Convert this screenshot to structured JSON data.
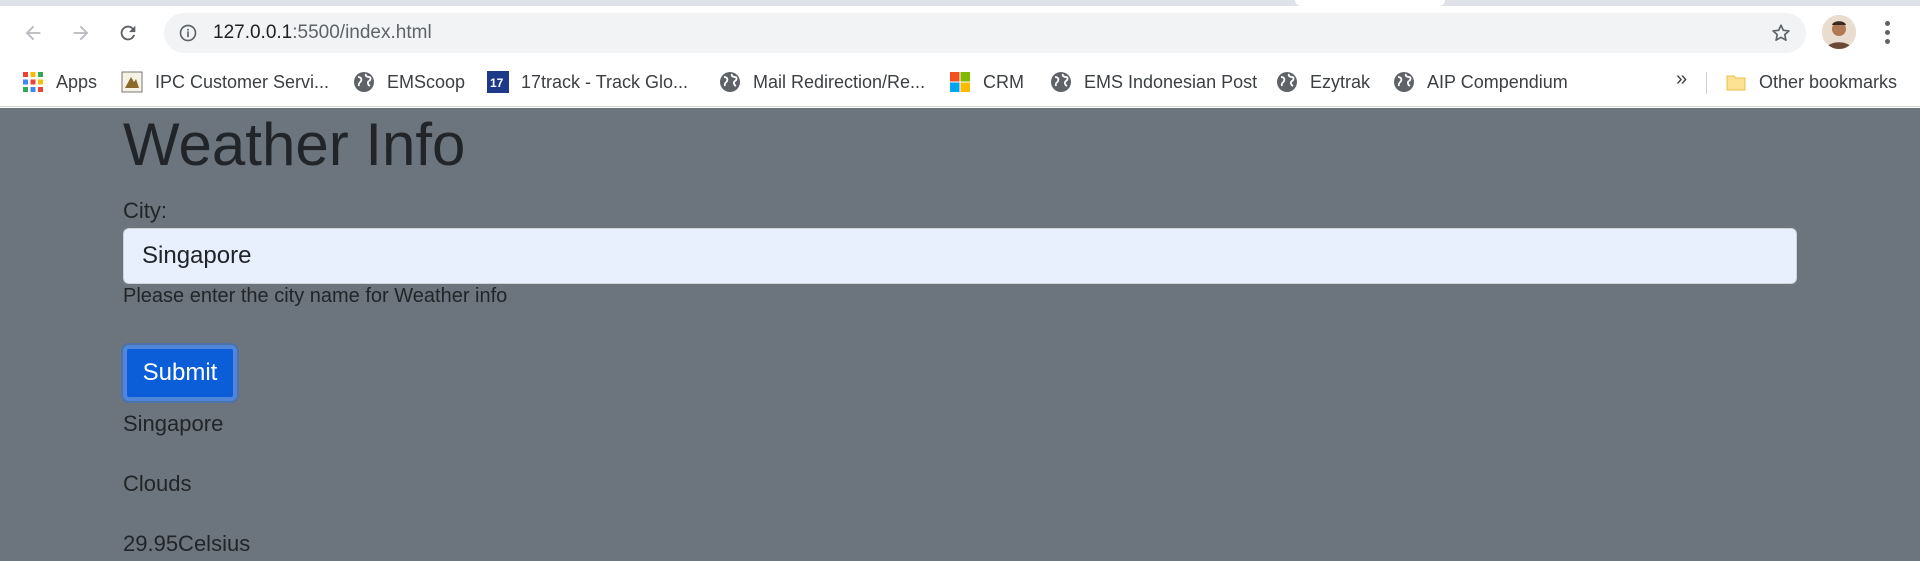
{
  "browser": {
    "url_host": "127.0.0.1",
    "url_path": ":5500/index.html",
    "bookmarks_more": "»",
    "bookmarks": [
      {
        "label": "Apps",
        "icon": "apps-grid-icon"
      },
      {
        "label": "IPC Customer Servi...",
        "icon": "ipc-logo-icon"
      },
      {
        "label": "EMScoop",
        "icon": "globe-icon"
      },
      {
        "label": "17track - Track Glo...",
        "icon": "17track-logo-icon"
      },
      {
        "label": "Mail Redirection/Re...",
        "icon": "globe-icon"
      },
      {
        "label": "CRM",
        "icon": "microsoft-logo-icon"
      },
      {
        "label": "EMS Indonesian Post",
        "icon": "globe-icon"
      },
      {
        "label": "Ezytrak",
        "icon": "globe-icon"
      },
      {
        "label": "AIP Compendium",
        "icon": "globe-icon"
      }
    ],
    "other_bookmarks": "Other bookmarks"
  },
  "page": {
    "title": "Weather Info",
    "city_label": "City:",
    "city_value": "Singapore",
    "help_text": "Please enter the city name for Weather info",
    "submit_label": "Submit",
    "results": {
      "city": "Singapore",
      "condition": "Clouds",
      "temperature": "29.95Celsius"
    }
  },
  "colors": {
    "page_background": "#6c757d",
    "button_primary": "#0b5ed7",
    "input_autofill": "#e8f0fe"
  }
}
